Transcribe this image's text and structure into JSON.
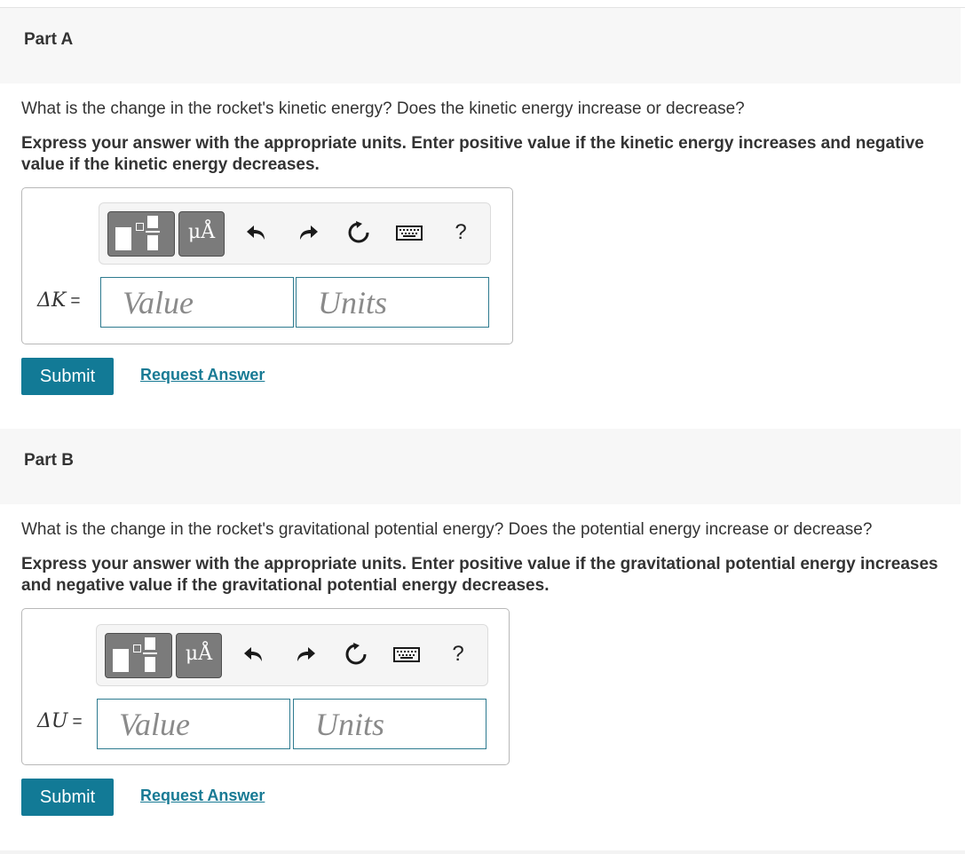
{
  "parts": [
    {
      "title": "Part A",
      "question": "What is the change in the rocket's kinetic energy? Does the kinetic energy increase or decrease?",
      "instruction": "Express your answer with the appropriate units. Enter positive value if the kinetic energy increases and negative value if the kinetic energy decreases.",
      "variable": "ΔK",
      "equals": "=",
      "value_placeholder": "Value",
      "units_placeholder": "Units",
      "mu_label": "μÅ",
      "help_label": "?",
      "submit_label": "Submit",
      "request_label": "Request Answer"
    },
    {
      "title": "Part B",
      "question": "What is the change in the rocket's gravitational potential energy? Does the potential energy increase or decrease?",
      "instruction": "Express your answer with the appropriate units. Enter positive value if the gravitational potential energy increases and negative value if the gravitational potential energy decreases.",
      "variable": "ΔU",
      "equals": "=",
      "value_placeholder": "Value",
      "units_placeholder": "Units",
      "mu_label": "μÅ",
      "help_label": "?",
      "submit_label": "Submit",
      "request_label": "Request Answer"
    }
  ],
  "icons": [
    "templates-icon",
    "units-icon",
    "undo-icon",
    "redo-icon",
    "reset-icon",
    "keyboard-icon",
    "help-icon"
  ],
  "colors": {
    "accent": "#127a96",
    "link": "#187a94",
    "header_bg": "#f7f7f7",
    "input_border": "#2d7a8f"
  }
}
